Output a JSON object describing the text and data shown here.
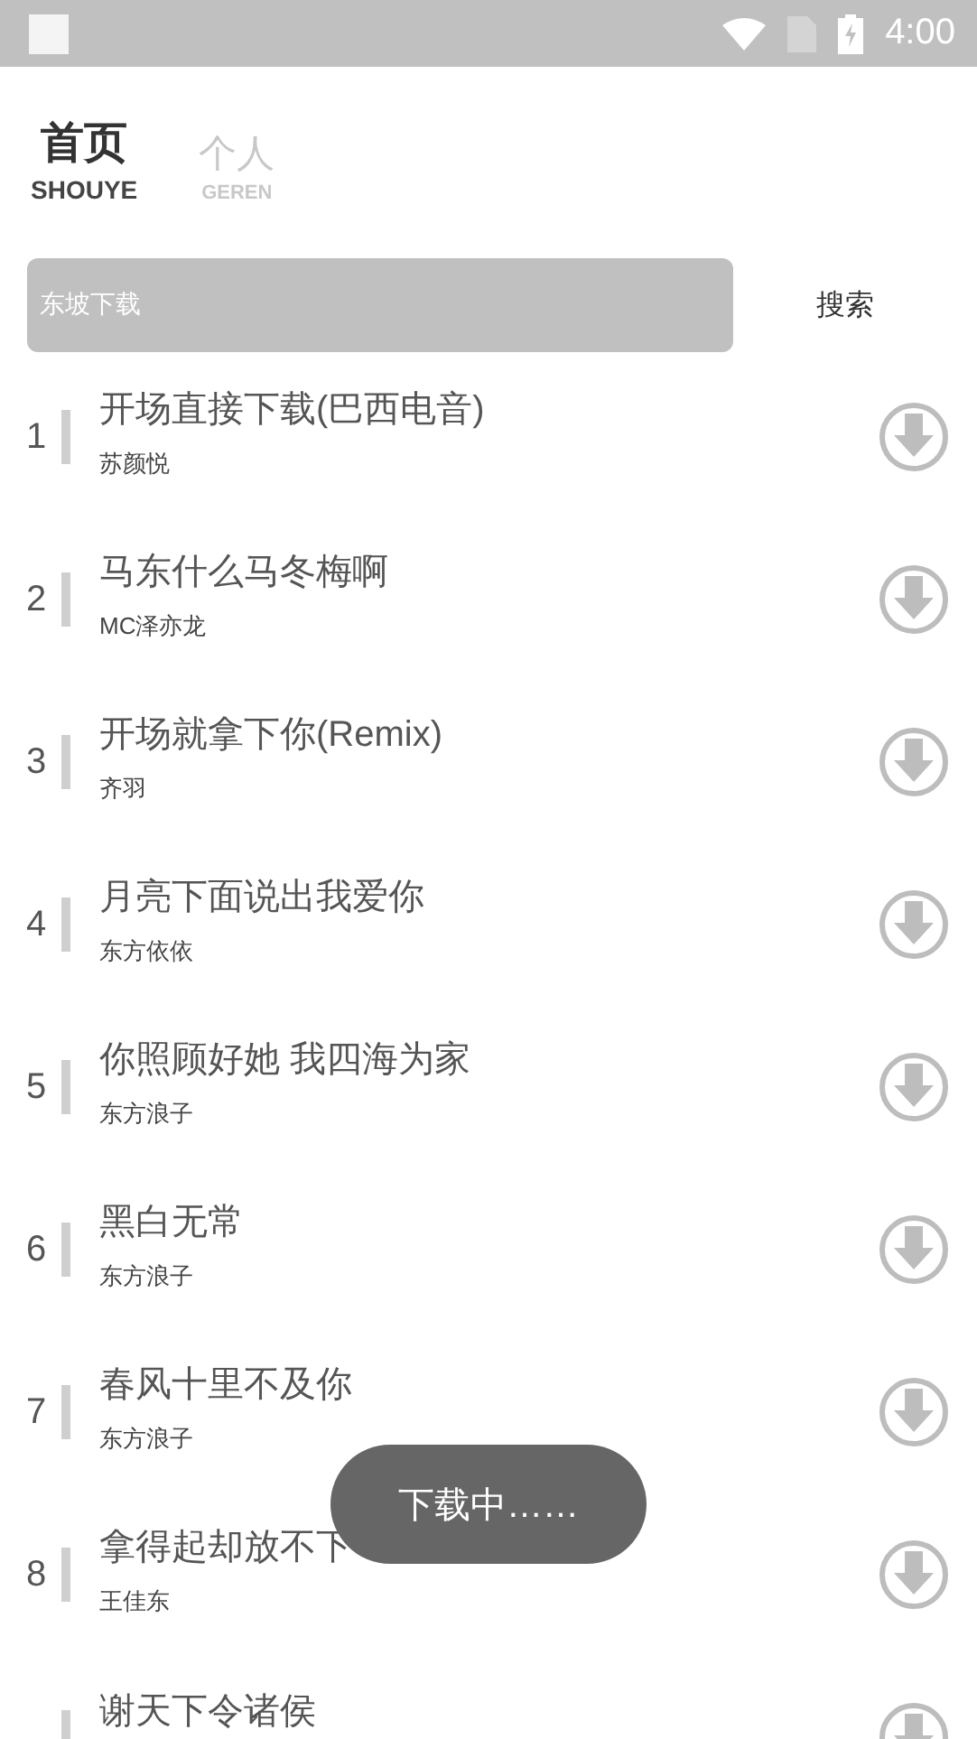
{
  "status_bar": {
    "time": "4:00"
  },
  "tabs": [
    {
      "label": "首页",
      "sublabel": "SHOUYE",
      "selected": true
    },
    {
      "label": "个人",
      "sublabel": "GEREN",
      "selected": false
    }
  ],
  "search": {
    "value": "东坡下载",
    "button": "搜索"
  },
  "songs": [
    {
      "index": "1",
      "title": "开场直接下载(巴西电音)",
      "artist": "苏颜悦"
    },
    {
      "index": "2",
      "title": "马东什么马冬梅啊",
      "artist": "MC泽亦龙"
    },
    {
      "index": "3",
      "title": "开场就拿下你(Remix)",
      "artist": "齐羽"
    },
    {
      "index": "4",
      "title": "月亮下面说出我爱你",
      "artist": "东方依依"
    },
    {
      "index": "5",
      "title": "你照顾好她 我四海为家",
      "artist": "东方浪子"
    },
    {
      "index": "6",
      "title": "黑白无常",
      "artist": "东方浪子"
    },
    {
      "index": "7",
      "title": "春风十里不及你",
      "artist": "东方浪子"
    },
    {
      "index": "8",
      "title": "拿得起却放不下",
      "artist": "王佳东"
    },
    {
      "title": "谢天下令诸侯"
    }
  ],
  "toast": "下载中……"
}
